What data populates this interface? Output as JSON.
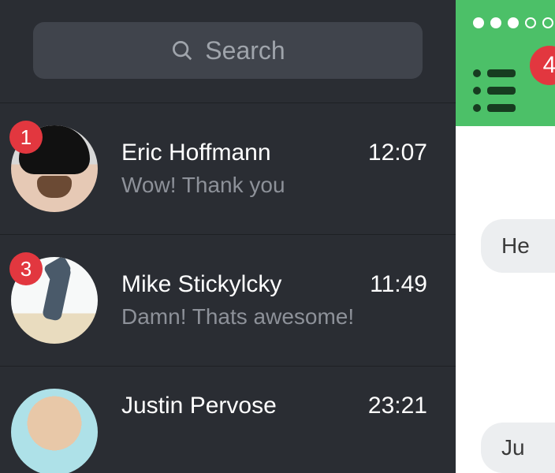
{
  "search": {
    "placeholder": "Search"
  },
  "conversations": [
    {
      "name": "Eric Hoffmann",
      "time": "12:07",
      "preview": "Wow! Thank you",
      "badge": "1"
    },
    {
      "name": "Mike Stickylcky",
      "time": "11:49",
      "preview": "Damn! Thats awesome!",
      "badge": "3"
    },
    {
      "name": "Justin Pervose",
      "time": "23:21",
      "preview": "",
      "badge": ""
    }
  ],
  "chat": {
    "header_badge": "4",
    "bubbles": [
      "He",
      "Ju"
    ]
  }
}
